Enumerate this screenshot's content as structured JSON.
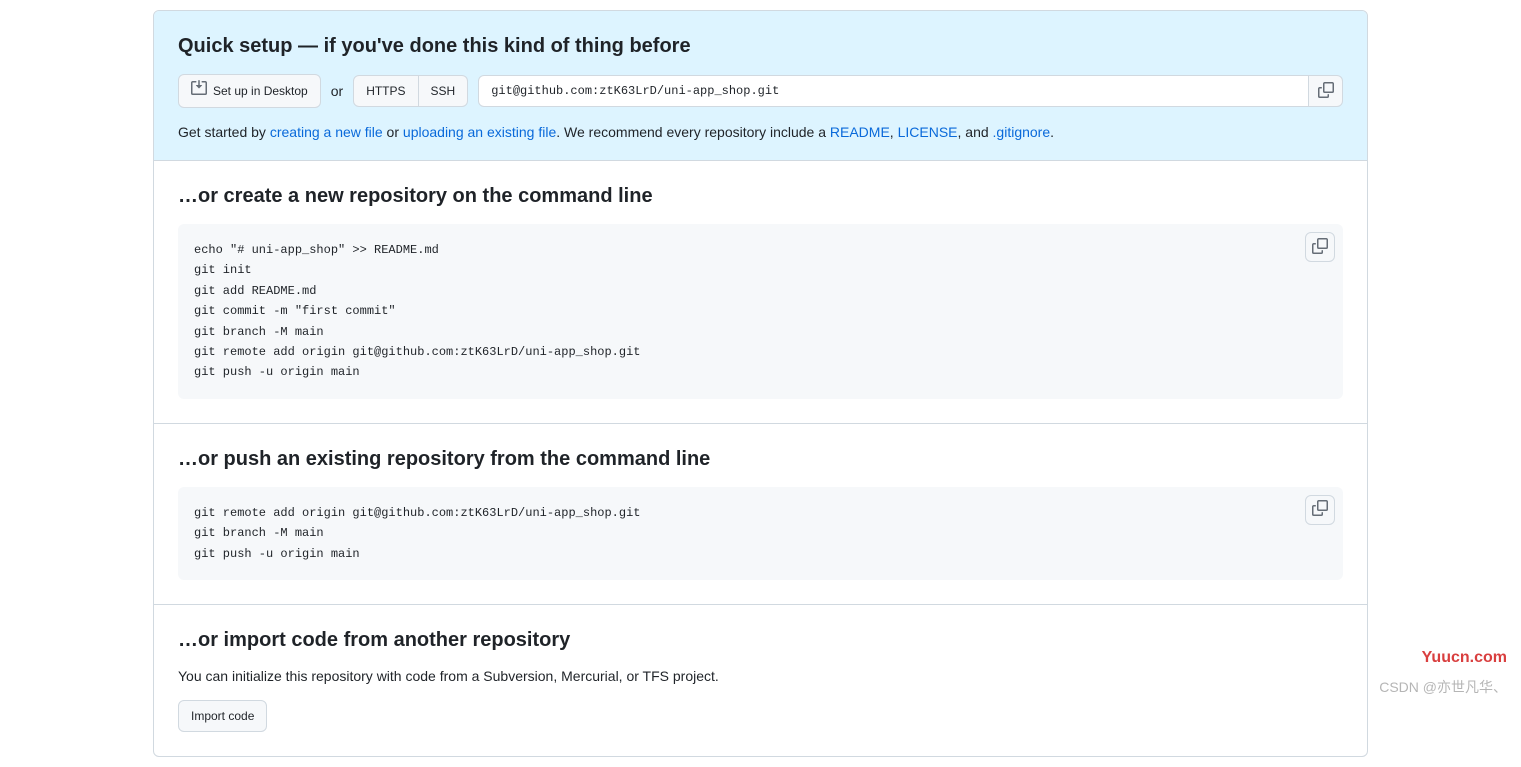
{
  "quick_setup": {
    "heading": "Quick setup — if you've done this kind of thing before",
    "desktop_button": "Set up in Desktop",
    "or": "or",
    "https_label": "HTTPS",
    "ssh_label": "SSH",
    "clone_url": "git@github.com:ztK63LrD/uni-app_shop.git",
    "desc_prefix": "Get started by ",
    "link_create": "creating a new file",
    "desc_mid1": " or ",
    "link_upload": "uploading an existing file",
    "desc_mid2": ". We recommend every repository include a ",
    "link_readme": "README",
    "desc_comma1": ", ",
    "link_license": "LICENSE",
    "desc_and": ", and ",
    "link_gitignore": ".gitignore",
    "desc_end": "."
  },
  "sections": {
    "create": {
      "heading": "…or create a new repository on the command line",
      "commands": "echo \"# uni-app_shop\" >> README.md\ngit init\ngit add README.md\ngit commit -m \"first commit\"\ngit branch -M main\ngit remote add origin git@github.com:ztK63LrD/uni-app_shop.git\ngit push -u origin main"
    },
    "push": {
      "heading": "…or push an existing repository from the command line",
      "commands": "git remote add origin git@github.com:ztK63LrD/uni-app_shop.git\ngit branch -M main\ngit push -u origin main"
    },
    "import": {
      "heading": "…or import code from another repository",
      "desc": "You can initialize this repository with code from a Subversion, Mercurial, or TFS project.",
      "button": "Import code"
    }
  },
  "watermarks": {
    "red": "Yuucn.com",
    "gray": "CSDN @亦世凡华、"
  }
}
